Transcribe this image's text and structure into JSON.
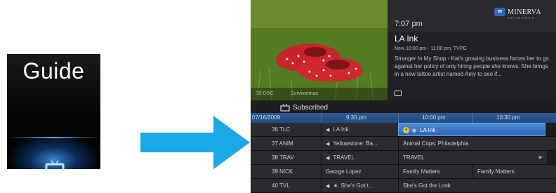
{
  "guide_tile": {
    "title": "Guide",
    "icon": "tv-icon"
  },
  "arrow": {
    "color": "#1aa8e6"
  },
  "screen": {
    "photo_caption": {
      "channel": "35  DSC",
      "show": "Survivorman"
    },
    "clock": "7:07 pm",
    "brand": {
      "badge": "m",
      "name": "MINERVA",
      "sub": "NETWORKS"
    },
    "program": {
      "title": "LA Ink",
      "meta": "New 10:00 pm - 11:00 pm, TVPG",
      "description": "Stranger In My Shop - Kat's growing business forces her to go against her policy of only hiring people she knows. She brings in a new tattoo artist named Amy to see if..."
    },
    "subscribed": {
      "label": "Subscribed"
    },
    "timebar": {
      "date": "07/16/2009",
      "t1": "9:30 pm",
      "t2": "10:00 pm",
      "t3": "10:30 pm"
    },
    "rows": [
      {
        "channel": "36 TLC",
        "c1": "LA Ink",
        "c2": "LA Ink"
      },
      {
        "channel": "37 ANIM",
        "c1": "Yellowstone: Ba...",
        "c2": "Animal Cops: Philadelphia"
      },
      {
        "channel": "38 TRAV",
        "c1": "TRAVEL",
        "c2": "TRAVEL"
      },
      {
        "channel": "39 NICK",
        "c1": "George Lopez",
        "c2": "Family Matters",
        "c3": "Family Matters"
      },
      {
        "channel": "40 TVL",
        "c1": "She's Got t...",
        "c2": "She's Got the Look"
      }
    ]
  }
}
